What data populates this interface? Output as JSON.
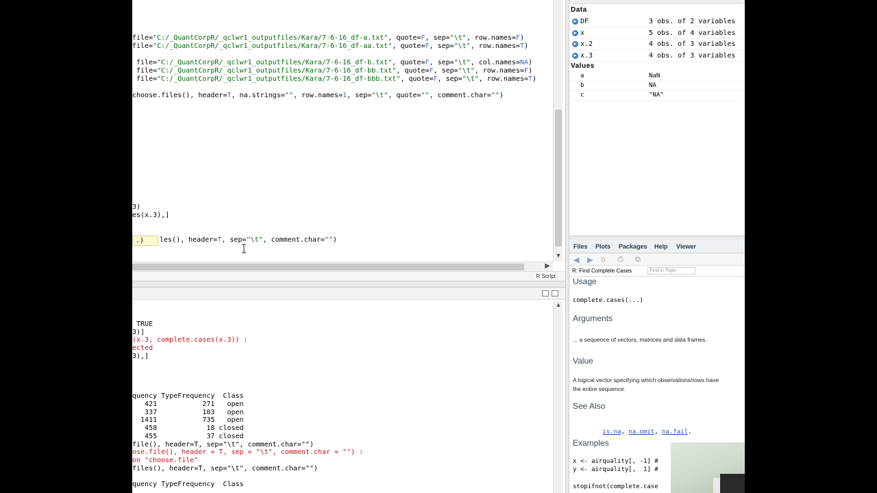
{
  "editor": {
    "lines": [
      [
        {
          "t": "file="
        },
        {
          "t": "\"C:/_QuantCorpR/_qclwr1_outputfiles/Kara/7-6-16_df-a.txt\"",
          "c": "str"
        },
        {
          "t": ", quote="
        },
        {
          "t": "F",
          "c": "const"
        },
        {
          "t": ", sep="
        },
        {
          "t": "\"\\t\"",
          "c": "str"
        },
        {
          "t": ", row.names="
        },
        {
          "t": "F",
          "c": "const"
        },
        {
          "t": ")"
        }
      ],
      [
        {
          "t": "file="
        },
        {
          "t": "\"C:/_QuantCorpR/_qclwr1_outputfiles/Kara/7-6-16_df-aa.txt\"",
          "c": "str"
        },
        {
          "t": ", quote="
        },
        {
          "t": "F",
          "c": "const"
        },
        {
          "t": ", sep="
        },
        {
          "t": "\"\\t\"",
          "c": "str"
        },
        {
          "t": ", row.names="
        },
        {
          "t": "T",
          "c": "const"
        },
        {
          "t": ")"
        }
      ],
      [
        {
          "t": ""
        }
      ],
      [
        {
          "t": " file="
        },
        {
          "t": "\"C:/_QuantCorpR/_qclwr1_outputfiles/Kara/7-6-16_df-b.txt\"",
          "c": "str"
        },
        {
          "t": ", quote="
        },
        {
          "t": "F",
          "c": "const"
        },
        {
          "t": ", sep="
        },
        {
          "t": "\"\\t\"",
          "c": "str"
        },
        {
          "t": ", col.names="
        },
        {
          "t": "NA",
          "c": "const"
        },
        {
          "t": ")"
        }
      ],
      [
        {
          "t": " file="
        },
        {
          "t": "\"C:/_QuantCorpR/_qclwr1_outputfiles/Kara/7-6-16_df-bb.txt\"",
          "c": "str"
        },
        {
          "t": ", quote="
        },
        {
          "t": "F",
          "c": "const"
        },
        {
          "t": ", sep="
        },
        {
          "t": "\"\\t\"",
          "c": "str"
        },
        {
          "t": ", row.names="
        },
        {
          "t": "F",
          "c": "const"
        },
        {
          "t": ")"
        }
      ],
      [
        {
          "t": " file="
        },
        {
          "t": "\"C:/_QuantCorpR/_qclwr1_outputfiles/Kara/7-6-16_df-bbb.txt\"",
          "c": "str"
        },
        {
          "t": ", quote="
        },
        {
          "t": "F",
          "c": "const"
        },
        {
          "t": ", sep="
        },
        {
          "t": "\"\\t\"",
          "c": "str"
        },
        {
          "t": ", row.names="
        },
        {
          "t": "T",
          "c": "const"
        },
        {
          "t": ")"
        }
      ],
      [
        {
          "t": ""
        }
      ],
      [
        {
          "t": "choose.files(), header="
        },
        {
          "t": "T",
          "c": "const"
        },
        {
          "t": ", na.strings="
        },
        {
          "t": "\"\"",
          "c": "str"
        },
        {
          "t": ", row.names="
        },
        {
          "t": "1",
          "c": "const"
        },
        {
          "t": ", sep="
        },
        {
          "t": "\"\\t\"",
          "c": "str"
        },
        {
          "t": ", quote="
        },
        {
          "t": "\"\"",
          "c": "str"
        },
        {
          "t": ", comment.char="
        },
        {
          "t": "\"\"",
          "c": "str"
        },
        {
          "t": ")"
        }
      ]
    ],
    "lower_lines": [
      [
        {
          "t": "3)"
        }
      ],
      [
        {
          "t": "es(x.3),]"
        }
      ]
    ],
    "autocomplete": ".)",
    "current_line": [
      {
        "t": "les(), header="
      },
      {
        "t": "T",
        "c": "const"
      },
      {
        "t": ", sep="
      },
      {
        "t": "\"\\t\"",
        "c": "str"
      },
      {
        "t": ", comment.char="
      },
      {
        "t": "\"\"",
        "c": "str"
      },
      {
        "t": ")"
      }
    ],
    "file_type": "R Script"
  },
  "console": {
    "lines": [
      {
        "t": " TRUE",
        "c": ""
      },
      {
        "t": "3)]",
        "c": ""
      },
      {
        "t": "(x.3, complete.cases(x.3)) :",
        "c": "err"
      },
      {
        "t": "ected",
        "c": "err"
      },
      {
        "t": "3),]",
        "c": ""
      },
      {
        "t": "",
        "c": ""
      },
      {
        "t": "",
        "c": ""
      },
      {
        "t": "",
        "c": ""
      },
      {
        "t": "",
        "c": ""
      },
      {
        "t": "quency TypeFrequency  Class",
        "c": ""
      },
      {
        "t": "   421           271   open",
        "c": ""
      },
      {
        "t": "   337           103   open",
        "c": ""
      },
      {
        "t": "  1411           735   open",
        "c": ""
      },
      {
        "t": "   458            18 closed",
        "c": ""
      },
      {
        "t": "   455            37 closed",
        "c": ""
      },
      {
        "t": "file(), header=T, sep=\"\\t\", comment.char=\"\")",
        "c": ""
      },
      {
        "t": "ose.file(), header = T, sep = \"\\t\", comment.char = \"\") :",
        "c": "err"
      },
      {
        "t": "on \"choose.file\"",
        "c": "err"
      },
      {
        "t": "files(), header=T, sep=\"\\t\", comment.char=\"\")",
        "c": ""
      },
      {
        "t": "",
        "c": ""
      },
      {
        "t": "quency TypeFrequency  Class",
        "c": ""
      }
    ]
  },
  "environment": {
    "data_header": "Data",
    "data": [
      {
        "name": "DF",
        "value": "3 obs. of 2 variables"
      },
      {
        "name": "x",
        "value": "5 obs. of 4 variables"
      },
      {
        "name": "x.2",
        "value": "4 obs. of 3 variables"
      },
      {
        "name": "x.3",
        "value": "4 obs. of 3 variables"
      }
    ],
    "values_header": "Values",
    "values": [
      {
        "name": "a",
        "value": "NaN"
      },
      {
        "name": "b",
        "value": "NA"
      },
      {
        "name": "c",
        "value": "\"NA\""
      }
    ]
  },
  "help": {
    "tabs": [
      "Files",
      "Plots",
      "Packages",
      "Help",
      "Viewer"
    ],
    "active_tab": "Help",
    "topic": "R: Find Complete Cases",
    "find_placeholder": "Find in Topic",
    "usage_h": "Usage",
    "usage_code": "complete.cases(...)",
    "arguments_h": "Arguments",
    "arguments_text": "... a sequence of vectors, matrices and data frames.",
    "value_h": "Value",
    "value_text_1": "A logical vector specifying which observations/rows have",
    "value_text_2": "the entire sequence.",
    "seealso_h": "See Also",
    "seealso_links": [
      "is.na",
      "na.omit",
      "na.fail"
    ],
    "examples_h": "Examples",
    "example_1": "x <- airquality[, -1] #",
    "example_2": "y <- airquality[,  1] #",
    "example_3": "stopifnot(complete.case"
  }
}
